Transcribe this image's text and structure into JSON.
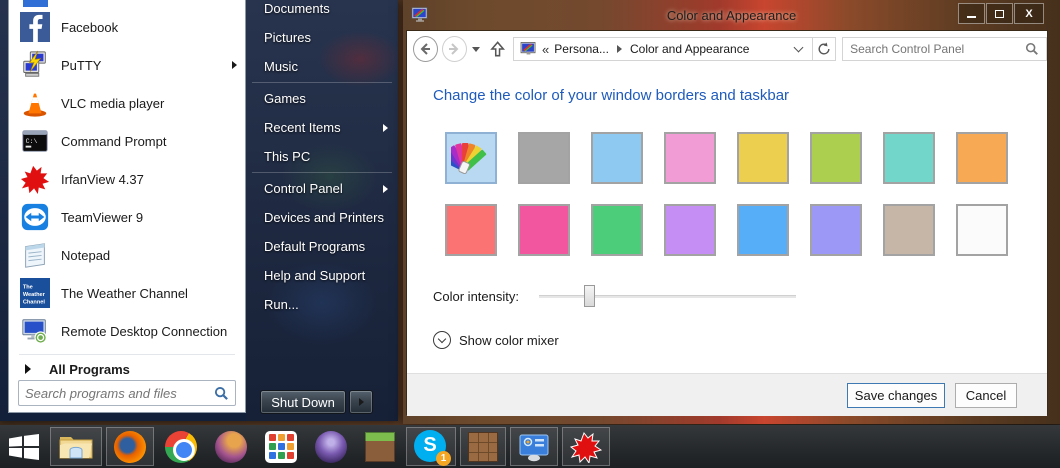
{
  "start_menu": {
    "left_items": [
      {
        "label": "Facebook",
        "submenu": false
      },
      {
        "label": "PuTTY",
        "submenu": true
      },
      {
        "label": "VLC media player",
        "submenu": false
      },
      {
        "label": "Command Prompt",
        "submenu": false
      },
      {
        "label": "IrfanView 4.37",
        "submenu": false
      },
      {
        "label": "TeamViewer 9",
        "submenu": false
      },
      {
        "label": "Notepad",
        "submenu": false
      },
      {
        "label": "The Weather Channel",
        "submenu": false
      },
      {
        "label": "Remote Desktop Connection",
        "submenu": false
      }
    ],
    "all_programs": "All Programs",
    "search_placeholder": "Search programs and files",
    "right_items": [
      {
        "label": "Documents",
        "submenu": false
      },
      {
        "label": "Pictures",
        "submenu": false
      },
      {
        "label": "Music",
        "submenu": false
      },
      {
        "label": "Games",
        "submenu": false
      },
      {
        "label": "Recent Items",
        "submenu": true
      },
      {
        "label": "This PC",
        "submenu": false
      },
      {
        "label": "Control Panel",
        "submenu": true
      },
      {
        "label": "Devices and Printers",
        "submenu": false
      },
      {
        "label": "Default Programs",
        "submenu": false
      },
      {
        "label": "Help and Support",
        "submenu": false
      },
      {
        "label": "Run...",
        "submenu": false
      }
    ],
    "shut_down": "Shut Down"
  },
  "window": {
    "title": "Color and Appearance",
    "toolbar": {
      "breadcrumb_overflow": "«",
      "breadcrumb_parent": "Persona...",
      "breadcrumb_current": "Color and Appearance",
      "search_placeholder": "Search Control Panel"
    },
    "heading": "Change the color of your window borders and taskbar",
    "swatches": {
      "row1": [
        {
          "name": "automatic",
          "color": "#b9d8f1"
        },
        {
          "name": "gray",
          "color": "#a6a6a6"
        },
        {
          "name": "light-blue",
          "color": "#8ec9f2"
        },
        {
          "name": "pink",
          "color": "#f19cd5"
        },
        {
          "name": "yellow",
          "color": "#eccf4e"
        },
        {
          "name": "green-yellow",
          "color": "#accf50"
        },
        {
          "name": "teal",
          "color": "#72d7ca"
        },
        {
          "name": "orange",
          "color": "#f8a953"
        }
      ],
      "row2": [
        {
          "name": "salmon",
          "color": "#fb7373"
        },
        {
          "name": "magenta",
          "color": "#f2569f"
        },
        {
          "name": "green",
          "color": "#4ccd79"
        },
        {
          "name": "light-purple",
          "color": "#c48ef4"
        },
        {
          "name": "blue",
          "color": "#57aef8"
        },
        {
          "name": "periwinkle",
          "color": "#9b98f6"
        },
        {
          "name": "tan",
          "color": "#c5b6a7"
        },
        {
          "name": "white",
          "color": "#fbfbfb"
        }
      ]
    },
    "intensity": {
      "label": "Color intensity:",
      "thumb_left": "17.5%"
    },
    "mixer_label": "Show color mixer",
    "buttons": {
      "save": "Save changes",
      "cancel": "Cancel"
    }
  },
  "taskbar": {
    "skype_badge": "1",
    "items": [
      "start",
      "file-explorer",
      "firefox",
      "chrome",
      "pale-moon",
      "app-grid",
      "eclipse",
      "minecraft",
      "skype",
      "crafting-table",
      "display-settings",
      "irfanview"
    ]
  },
  "accent_colors": {
    "heading_blue": "#1e5bbd",
    "save_border": "#3e79b4",
    "glass_brown": "#6e4a2c"
  }
}
